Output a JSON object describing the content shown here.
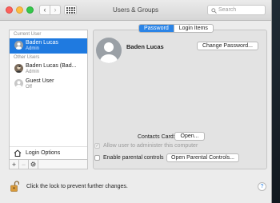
{
  "window": {
    "title": "Users & Groups"
  },
  "search": {
    "placeholder": "Search"
  },
  "sidebar": {
    "current_user_header": "Current User",
    "other_users_header": "Other Users",
    "users": [
      {
        "name": "Baden Lucas",
        "role": "Admin"
      },
      {
        "name": "Baden Lucas (Bad...",
        "role": "Admin"
      },
      {
        "name": "Guest User",
        "role": "Off"
      }
    ],
    "login_options_label": "Login Options",
    "add_label": "+",
    "remove_label": "−"
  },
  "tabs": [
    {
      "label": "Password"
    },
    {
      "label": "Login Items"
    }
  ],
  "detail": {
    "user_name": "Baden Lucas",
    "change_password_label": "Change Password...",
    "contacts_card_label": "Contacts Card:",
    "open_label": "Open...",
    "allow_admin_label": "Allow user to administer this computer",
    "allow_admin_checked": true,
    "parental_label": "Enable parental controls",
    "parental_checked": false,
    "open_parental_label": "Open Parental Controls..."
  },
  "footer": {
    "lock_text": "Click the lock to prevent further changes.",
    "help_label": "?"
  },
  "colors": {
    "selection": "#1f7ae0",
    "tab_active": "#2b84e6"
  }
}
